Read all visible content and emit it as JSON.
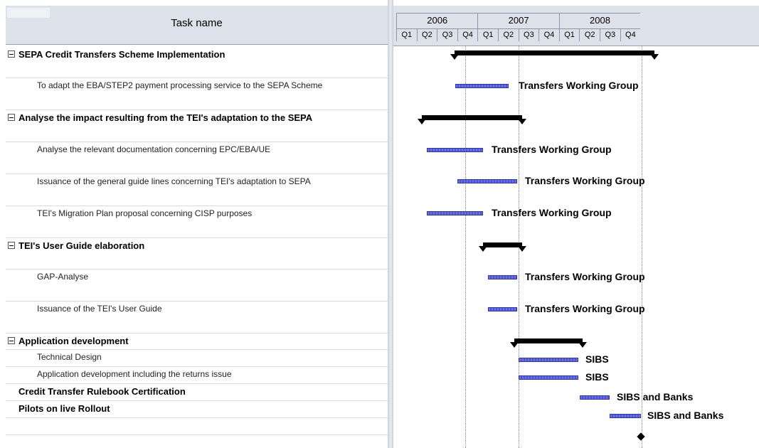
{
  "header": {
    "task_name_label": "Task name"
  },
  "timeline": {
    "years": [
      "2006",
      "2007",
      "2008"
    ],
    "quarters": [
      "Q1",
      "Q2",
      "Q3",
      "Q4",
      "Q1",
      "Q2",
      "Q3",
      "Q4",
      "Q1",
      "Q2",
      "Q3",
      "Q4"
    ]
  },
  "tasks": [
    {
      "name": "SEPA Credit Transfers Scheme Implementation",
      "summary": true,
      "collapsible": true
    },
    {
      "name": "To adapt the  EBA/STEP2 payment processing service to the SEPA Scheme",
      "summary": false,
      "resource": "Transfers Working Group"
    },
    {
      "name": "Analyse the impact resulting from the TEI's adaptation to the SEPA",
      "summary": true,
      "collapsible": true
    },
    {
      "name": "Analyse the relevant documentation concerning EPC/EBA/UE",
      "summary": false,
      "resource": "Transfers Working Group"
    },
    {
      "name": "Issuance of the general guide lines concerning TEI's adaptation to SEPA",
      "summary": false,
      "resource": "Transfers Working Group"
    },
    {
      "name": "TEI's Migration Plan proposal concerning CISP purposes",
      "summary": false,
      "resource": "Transfers Working Group"
    },
    {
      "name": "TEI's User Guide elaboration",
      "summary": true,
      "collapsible": true
    },
    {
      "name": "GAP-Analyse",
      "summary": false,
      "resource": "Transfers Working Group"
    },
    {
      "name": "Issuance of the TEI's User Guide",
      "summary": false,
      "resource": "Transfers Working Group"
    },
    {
      "name": "Application development",
      "summary": true,
      "collapsible": true
    },
    {
      "name": "Technical Design",
      "summary": false,
      "resource": "SIBS"
    },
    {
      "name": "Application development including the returns issue",
      "summary": false,
      "resource": "SIBS"
    },
    {
      "name": "Credit Transfer Rulebook Certification",
      "summary": true,
      "collapsible": false,
      "resource": "SIBS and Banks"
    },
    {
      "name": "Pilots on live Rollout",
      "summary": true,
      "collapsible": false,
      "resource": "SIBS and Banks"
    }
  ],
  "colors": {
    "task_bar": "#4d55d6",
    "summary_bar": "#000000",
    "header_bg": "#dde2ea"
  }
}
